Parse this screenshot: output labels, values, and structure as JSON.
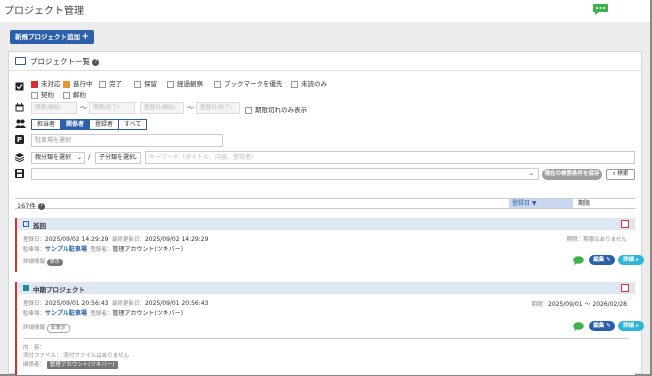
{
  "app": {
    "title": "プロジェクト管理"
  },
  "toolbar": {
    "new_project_label": "新規プロジェクト追加",
    "plus": "+"
  },
  "panel": {
    "title": "プロジェクト一覧",
    "help": "?"
  },
  "filters": {
    "status": [
      {
        "label": "未対応",
        "color": "#d9302c",
        "checked": true
      },
      {
        "label": "進行中",
        "color": "#e8952e",
        "checked": true
      },
      {
        "label": "完了",
        "checked": false
      },
      {
        "label": "保留",
        "checked": false
      },
      {
        "label": "経過観察",
        "checked": false
      },
      {
        "label": "ブックマークを優先",
        "checked": false
      },
      {
        "label": "未読のみ",
        "checked": false
      },
      {
        "label": "契約",
        "checked": false
      },
      {
        "label": "解約",
        "checked": false
      }
    ],
    "dates": {
      "deadline_start": "期限(開始)",
      "deadline_end": "期限(終了)",
      "reg_start": "登録日(開始)",
      "reg_end": "登録日(終了)",
      "tilde": "〜",
      "expired_only": "期限切れのみ表示"
    },
    "role_tabs": [
      "担当者",
      "関係者",
      "登録者",
      "すべて"
    ],
    "role_active": "関係者",
    "parking_placeholder": "駐車場を選択",
    "category_main": "親分類を選択",
    "category_sep": "/",
    "category_sub": "子分類を選択",
    "keyword_placeholder": "キーワード（タイトル、内容、登録者）",
    "save_condition": "現在の検索条件を保存",
    "search": "検索"
  },
  "list": {
    "count": "167件",
    "help": "?",
    "col_regdate": "登録日 ▼",
    "col_deadline": "期限"
  },
  "cards": [
    {
      "title": "巡回",
      "status_color": "#2b5faa",
      "reg_label": "登録日：",
      "reg_date": "2025/09/02 14:29:29",
      "upd_label": "最終更新日：",
      "upd_date": "2025/09/02 14:29:29",
      "deadline_label": "期限：",
      "deadline": "期限はありません",
      "parking_label": "駐車場：",
      "parking": "サンプル駐車場",
      "owner_label": "登録者：",
      "owner": "管理アカウント(ツキバー)",
      "detail_label": "詳細情報",
      "detail_toggle": "表示",
      "edit": "編集",
      "detail": "詳細"
    },
    {
      "title": "中期プロジェクト",
      "status_color": "#1a8f8f",
      "reg_label": "登録日：",
      "reg_date": "2025/09/01 20:56:43",
      "upd_label": "最終更新日：",
      "upd_date": "2025/09/01 20:56:43",
      "deadline_label": "期限：",
      "deadline": "2025/09/01 〜 2026/02/28",
      "parking_label": "駐車場：",
      "parking": "サンプル駐車場",
      "owner_label": "登録者：",
      "owner": "管理アカウント(ツキバー)",
      "detail_label": "詳細情報",
      "detail_toggle": "非表示",
      "edit": "編集",
      "detail": "詳細",
      "content_label": "内　容：",
      "attach_label": "添付ファイル：",
      "attach_value": "添付ファイルはありません",
      "members_label": "関係者：",
      "member": "管理アカウント(ツキバー)"
    }
  ]
}
